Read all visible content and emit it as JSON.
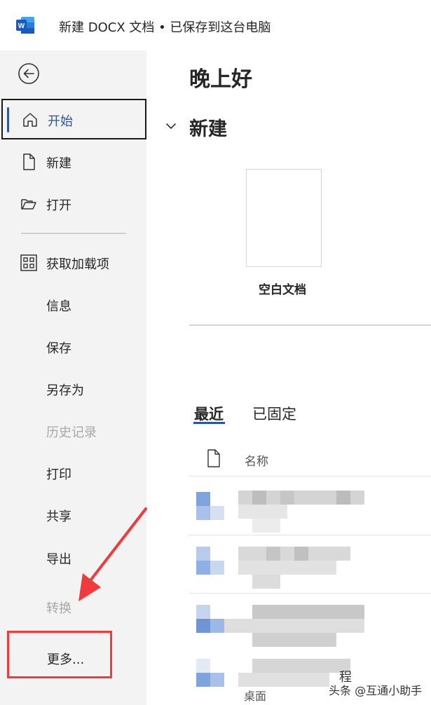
{
  "titlebar": {
    "app_icon": "word-logo-icon",
    "title": "新建 DOCX 文档 • 已保存到这台电脑"
  },
  "sidebar": {
    "back_icon": "back-arrow-icon",
    "items": [
      {
        "label": "开始",
        "icon": "home-icon",
        "state": "active"
      },
      {
        "label": "新建",
        "icon": "new-document-icon",
        "state": "normal"
      },
      {
        "label": "打开",
        "icon": "folder-open-icon",
        "state": "normal"
      },
      {
        "label": "获取加载项",
        "icon": "add-ins-grid-icon",
        "state": "normal"
      },
      {
        "label": "信息",
        "state": "normal"
      },
      {
        "label": "保存",
        "state": "normal"
      },
      {
        "label": "另存为",
        "state": "normal"
      },
      {
        "label": "历史记录",
        "state": "disabled"
      },
      {
        "label": "打印",
        "state": "normal"
      },
      {
        "label": "共享",
        "state": "normal"
      },
      {
        "label": "导出",
        "state": "normal"
      },
      {
        "label": "转换",
        "state": "disabled"
      }
    ],
    "more_label": "更多..."
  },
  "main": {
    "greeting": "晚上好",
    "new_section": {
      "heading": "新建",
      "collapse_icon": "chevron-down-icon",
      "templates": [
        {
          "label": "空白文档"
        }
      ]
    },
    "tabs": [
      {
        "label": "最近",
        "active": true
      },
      {
        "label": "已固定",
        "active": false
      }
    ],
    "file_list": {
      "header_icon": "document-icon",
      "column_name": "名称",
      "partial_text_row4": "程",
      "partial_text_row4_sub": "桌面"
    }
  },
  "annotation": {
    "color": "#ef3b3b",
    "description_icon": "red-arrow-icon"
  },
  "watermark": "头条 @互通小助手",
  "colors": {
    "accent": "#2b579a",
    "sidebar_bg": "#f3f3f3",
    "highlight_red": "#ef3b3b"
  }
}
